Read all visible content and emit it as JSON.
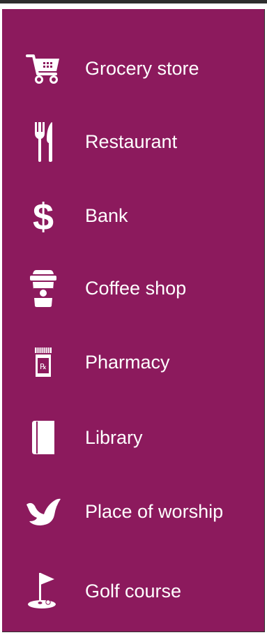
{
  "colors": {
    "panel_background": "#8c1a5d",
    "icon_color": "#ffffff",
    "text_color": "#ffffff",
    "border": "#2e2e2e"
  },
  "legend": {
    "items": [
      {
        "label": "Grocery store",
        "icon": "shopping-cart-icon"
      },
      {
        "label": "Restaurant",
        "icon": "fork-knife-icon"
      },
      {
        "label": "Bank",
        "icon": "dollar-sign-icon"
      },
      {
        "label": "Coffee shop",
        "icon": "coffee-cup-icon"
      },
      {
        "label": "Pharmacy",
        "icon": "pill-bottle-icon"
      },
      {
        "label": "Library",
        "icon": "book-icon"
      },
      {
        "label": "Place of worship",
        "icon": "dove-icon"
      },
      {
        "label": "Golf course",
        "icon": "golf-flag-icon"
      }
    ]
  }
}
